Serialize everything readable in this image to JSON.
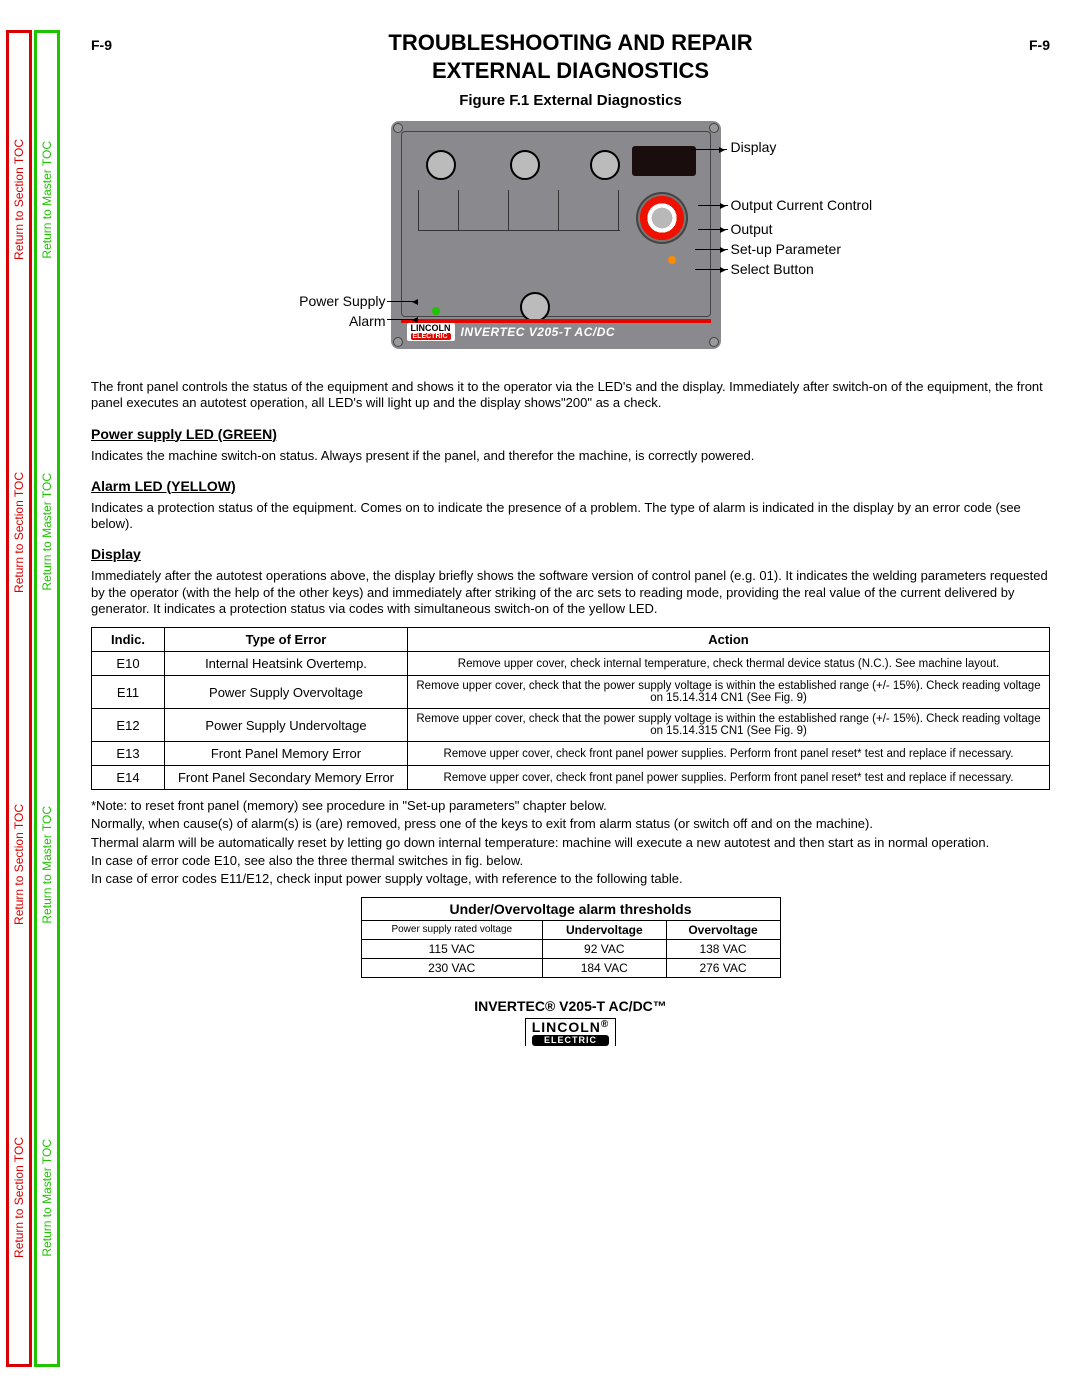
{
  "sidebar": {
    "section_toc": "Return to Section TOC",
    "master_toc": "Return to Master TOC",
    "repeat": 4
  },
  "page_num": "F-9",
  "title_a": "TROUBLESHOOTING AND REPAIR",
  "title_b": "EXTERNAL DIAGNOSTICS",
  "figure_caption": "Figure F.1  External Diagnostics",
  "figure_labels": {
    "display": "Display",
    "occ": "Output Current Control",
    "output": "Output",
    "setup": "Set-up Parameter",
    "select": "Select Button",
    "power_supply": "Power Supply",
    "alarm": "Alarm"
  },
  "panel_brand": {
    "logo_top": "LINCOLN",
    "logo_bottom": "ELECTRIC",
    "model": "INVERTEC V205-T AC/DC"
  },
  "intro": "The front panel controls the status of the equipment and shows it to the operator via the LED's and the display.  Immediately after switch-on of the equipment, the front panel executes an autotest operation, all LED's will light up and the display shows\"200\" as a check.",
  "sections": {
    "power_h": "Power supply LED (GREEN)",
    "power_t": "Indicates the machine switch-on status.  Always present if the panel, and therefor the machine, is correctly powered.",
    "alarm_h": "Alarm LED (YELLOW)",
    "alarm_t": "Indicates a protection status of the equipment.  Comes on to indicate the presence of a problem.  The type of alarm is indicated in the display by an error code (see below).",
    "disp_h": "Display",
    "disp_t": "Immediately after the autotest operations above, the display briefly shows the software version of control panel (e.g. 01). It indicates the welding parameters requested by the operator (with the help of the other keys) and immediately after striking of the arc sets to reading mode, providing the real value of the current delivered by generator.  It indicates a protection status via codes with simultaneous switch-on of the yellow LED."
  },
  "error_table": {
    "headers": {
      "indic": "Indic.",
      "type": "Type of Error",
      "action": "Action"
    },
    "rows": [
      {
        "indic": "E10",
        "type": "Internal Heatsink Overtemp.",
        "action": "Remove upper cover, check internal temperature, check thermal device status (N.C.).  See machine layout."
      },
      {
        "indic": "E11",
        "type": "Power Supply Overvoltage",
        "action": "Remove upper cover, check that the power supply voltage is within the established range (+/- 15%). Check reading voltage on 15.14.314 CN1 (See Fig. 9)"
      },
      {
        "indic": "E12",
        "type": "Power Supply Undervoltage",
        "action": "Remove upper cover, check that the power supply voltage is within the established range (+/- 15%). Check reading voltage on 15.14.315 CN1 (See Fig. 9)"
      },
      {
        "indic": "E13",
        "type": "Front Panel Memory Error",
        "action": "Remove upper cover, check front panel power supplies.  Perform front panel reset* test and replace if necessary."
      },
      {
        "indic": "E14",
        "type": "Front Panel Secondary Memory Error",
        "action": "Remove upper cover, check front panel power supplies.  Perform front panel reset* test and replace if necessary."
      }
    ]
  },
  "notes": [
    "*Note: to reset front panel (memory) see procedure in \"Set-up parameters\" chapter below.",
    " Normally, when cause(s) of alarm(s) is (are) removed, press one of the keys to exit from alarm status (or switch off and on the machine).",
    "Thermal alarm will be automatically reset by letting go down internal temperature: machine will execute a new autotest and then start as in normal operation.",
    "In case of error code E10, see also the three thermal switches in fig. below.",
    "In case of error codes E11/E12, check input power supply voltage, with reference to the following table."
  ],
  "volt_table": {
    "caption": "Under/Overvoltage alarm thresholds",
    "headers": {
      "rated": "Power supply rated voltage",
      "under": "Undervoltage",
      "over": "Overvoltage"
    },
    "rows": [
      {
        "rated": "115 VAC",
        "under": "92 VAC",
        "over": "138 VAC"
      },
      {
        "rated": "230 VAC",
        "under": "184 VAC",
        "over": "276 VAC"
      }
    ]
  },
  "footer": {
    "product": "INVERTEC® V205-T AC/DC™",
    "logo_top": "LINCOLN",
    "logo_sub": "ELECTRIC",
    "reg": "®"
  }
}
